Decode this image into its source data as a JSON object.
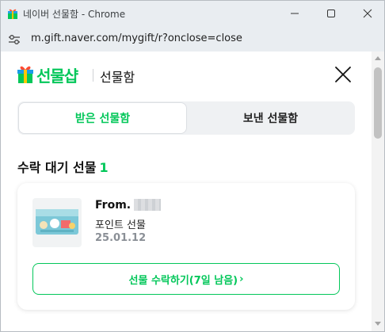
{
  "window": {
    "title": "네이버 선물함 - Chrome",
    "url": "m.gift.naver.com/mygift/r?onclose=close"
  },
  "header": {
    "brand": "선물샵",
    "title": "선물함"
  },
  "tabs": [
    {
      "label": "받은 선물함",
      "active": true
    },
    {
      "label": "보낸 선물함",
      "active": false
    }
  ],
  "section": {
    "title": "수락 대기 선물",
    "count": "1"
  },
  "gift": {
    "from_label": "From.",
    "product": "포인트 선물",
    "date": "25.01.12",
    "accept_label": "선물 수락하기(7일 남음)",
    "accept_chevron": "›"
  },
  "colors": {
    "accent": "#03c75a",
    "tab_bg": "#eff1f3",
    "muted_text": "#8a8f96"
  },
  "icons": [
    "naver-gift-icon",
    "site-settings-icon",
    "minimize-icon",
    "maximize-icon",
    "close-window-icon",
    "gift-box-logo-icon",
    "close-icon"
  ]
}
